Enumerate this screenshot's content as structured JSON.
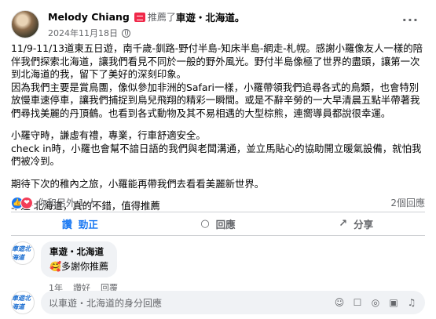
{
  "post": {
    "author": "Melody Chiang",
    "verb": "推薦了",
    "page": "車遊・北海道",
    "period": "。",
    "date": "2024年11月18日",
    "more": "···",
    "body": [
      "11/9-11/13道東五日遊，南千歲-釧路-野付半島-知床半島-網走-札幌。感謝小羅像友人一樣的陪伴我們探索北海道，讓我們看見不同於一般的野外風光。野付半島像極了世界的盡頭，讓第一次到北海道的我，留下了美好的深刻印象。",
      "因為我們主要是賞鳥團，像似參加非洲的Safari一樣，小羅帶領我們追尋各式的鳥類，也會特別放慢車速停車，讓我們捕捉到鳥兒飛翔的精彩一瞬間。或是不辭辛勞的一大早清晨五點半帶著我們尋找美麗的丹頂鶴。也看到各式動物及其不易相遇的大型棕熊，連嚮導員都說很幸運。",
      "",
      "小羅守時，謙虛有禮，專業，行車舒適安全。",
      "check in時，小羅也會幫不諳日語的我們與老闆溝通，並立馬貼心的協助開立暖氣設備，就怕我們被冷到。",
      "",
      "期待下次的稚內之旅，小羅能再帶我們去看看美麗新世界。",
      "",
      "車遊‧北海道，真的不錯，值得推薦"
    ]
  },
  "stats": {
    "like_icon": "👍",
    "love_icon": "❤",
    "reactions_text": "你和另外 1 人",
    "comments_text": "2個回應"
  },
  "actions": {
    "like": "讚",
    "like_label": "勁正",
    "comment_icon": "○",
    "comment_label": "回應",
    "share_icon": "↗",
    "share_label": "分享"
  },
  "comment": {
    "avatar_text": "車遊北海道",
    "author": "車遊・北海道",
    "text": "🥰多謝你推薦",
    "time": "1年",
    "like": "讚好",
    "reply": "回覆"
  },
  "reply_box": {
    "avatar_text": "車遊北海道",
    "placeholder": "以車遊・北海道的身分回應",
    "icons": [
      "☺",
      "☐",
      "◎",
      "▣",
      "♫"
    ]
  }
}
